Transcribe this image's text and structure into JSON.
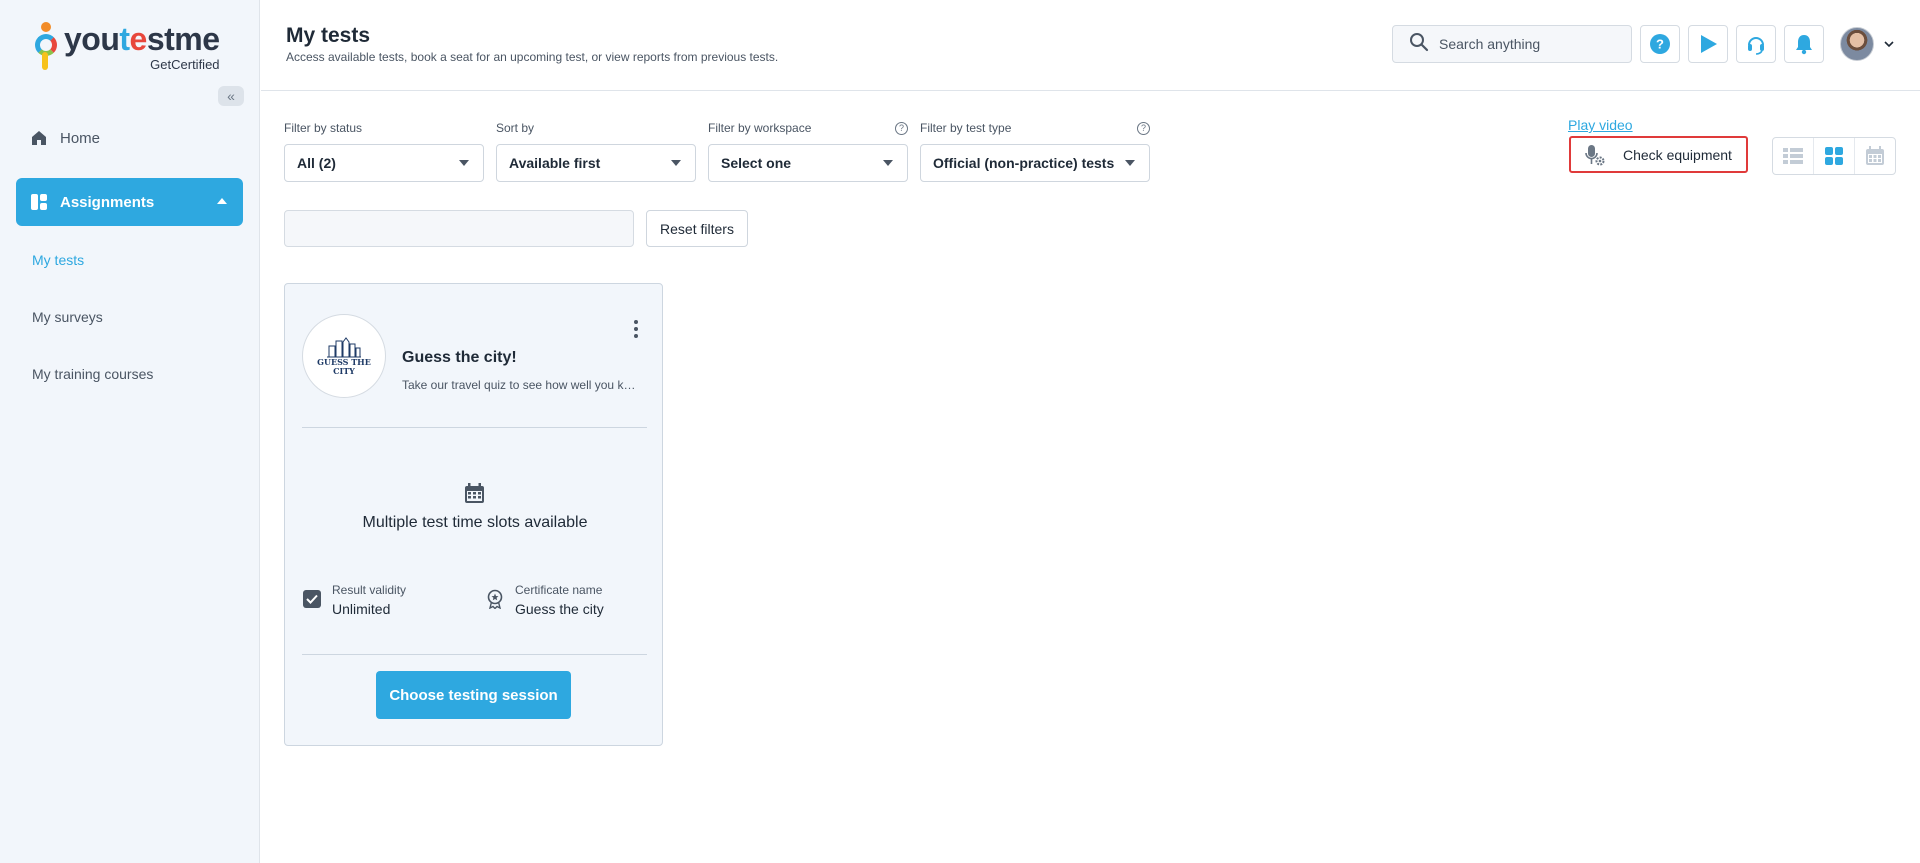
{
  "brand": {
    "word_a": "you",
    "word_t": "t",
    "word_e": "e",
    "word_b": "stme",
    "sub": "GetCertified"
  },
  "sidebar": {
    "home": "Home",
    "assignments": "Assignments",
    "items": [
      "My tests",
      "My surveys",
      "My training courses"
    ]
  },
  "header": {
    "title": "My tests",
    "subtitle": "Access available tests, book a seat for an upcoming test, or view reports from previous tests.",
    "search_placeholder": "Search anything"
  },
  "filters": {
    "status": {
      "label": "Filter by status",
      "value": "All (2)"
    },
    "sort": {
      "label": "Sort by",
      "value": "Available first"
    },
    "workspace": {
      "label": "Filter by workspace",
      "value": "Select one"
    },
    "test_type": {
      "label": "Filter by test type",
      "value": "Official (non-practice) tests"
    },
    "reset": "Reset filters"
  },
  "toolbar": {
    "play_video": "Play video",
    "check_equipment": "Check equipment"
  },
  "card": {
    "logo_text": [
      "GUESS THE",
      "CITY"
    ],
    "title": "Guess the city!",
    "description": "Take our travel quiz to see how well you know the cities of the world",
    "slots": "Multiple test time slots available",
    "validity_label": "Result validity",
    "validity_value": "Unlimited",
    "cert_label": "Certificate name",
    "cert_value": "Guess the city",
    "button": "Choose testing session"
  },
  "colors": {
    "accent": "#2ea8e0",
    "highlight": "#e03a3a"
  }
}
